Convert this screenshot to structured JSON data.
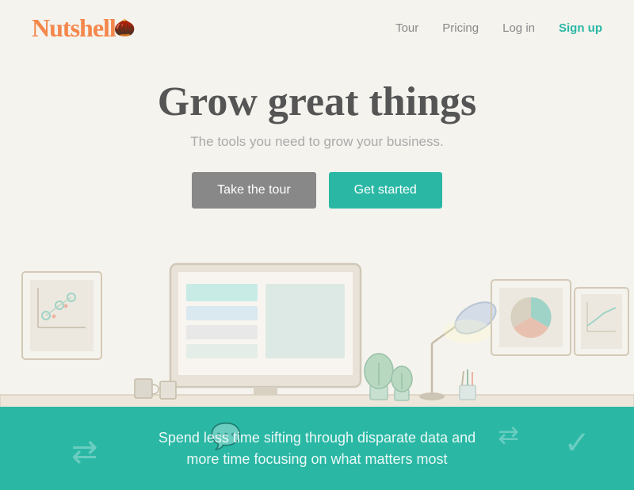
{
  "nav": {
    "logo": "Nutshell",
    "links": [
      {
        "label": "Tour",
        "id": "tour"
      },
      {
        "label": "Pricing",
        "id": "pricing"
      },
      {
        "label": "Log in",
        "id": "login"
      },
      {
        "label": "Sign up",
        "id": "signup"
      }
    ]
  },
  "hero": {
    "title": "Grow great things",
    "subtitle": "The tools you need to grow your business.",
    "btn_tour": "Take the tour",
    "btn_started": "Get started"
  },
  "bottom": {
    "line1": "Spend less time sifting through disparate data and",
    "line2": "more time focusing on what matters most"
  },
  "colors": {
    "orange": "#f4874b",
    "teal": "#2ab8a5",
    "gray_btn": "#888888",
    "text_dark": "#555555",
    "text_light": "#aaaaaa"
  }
}
